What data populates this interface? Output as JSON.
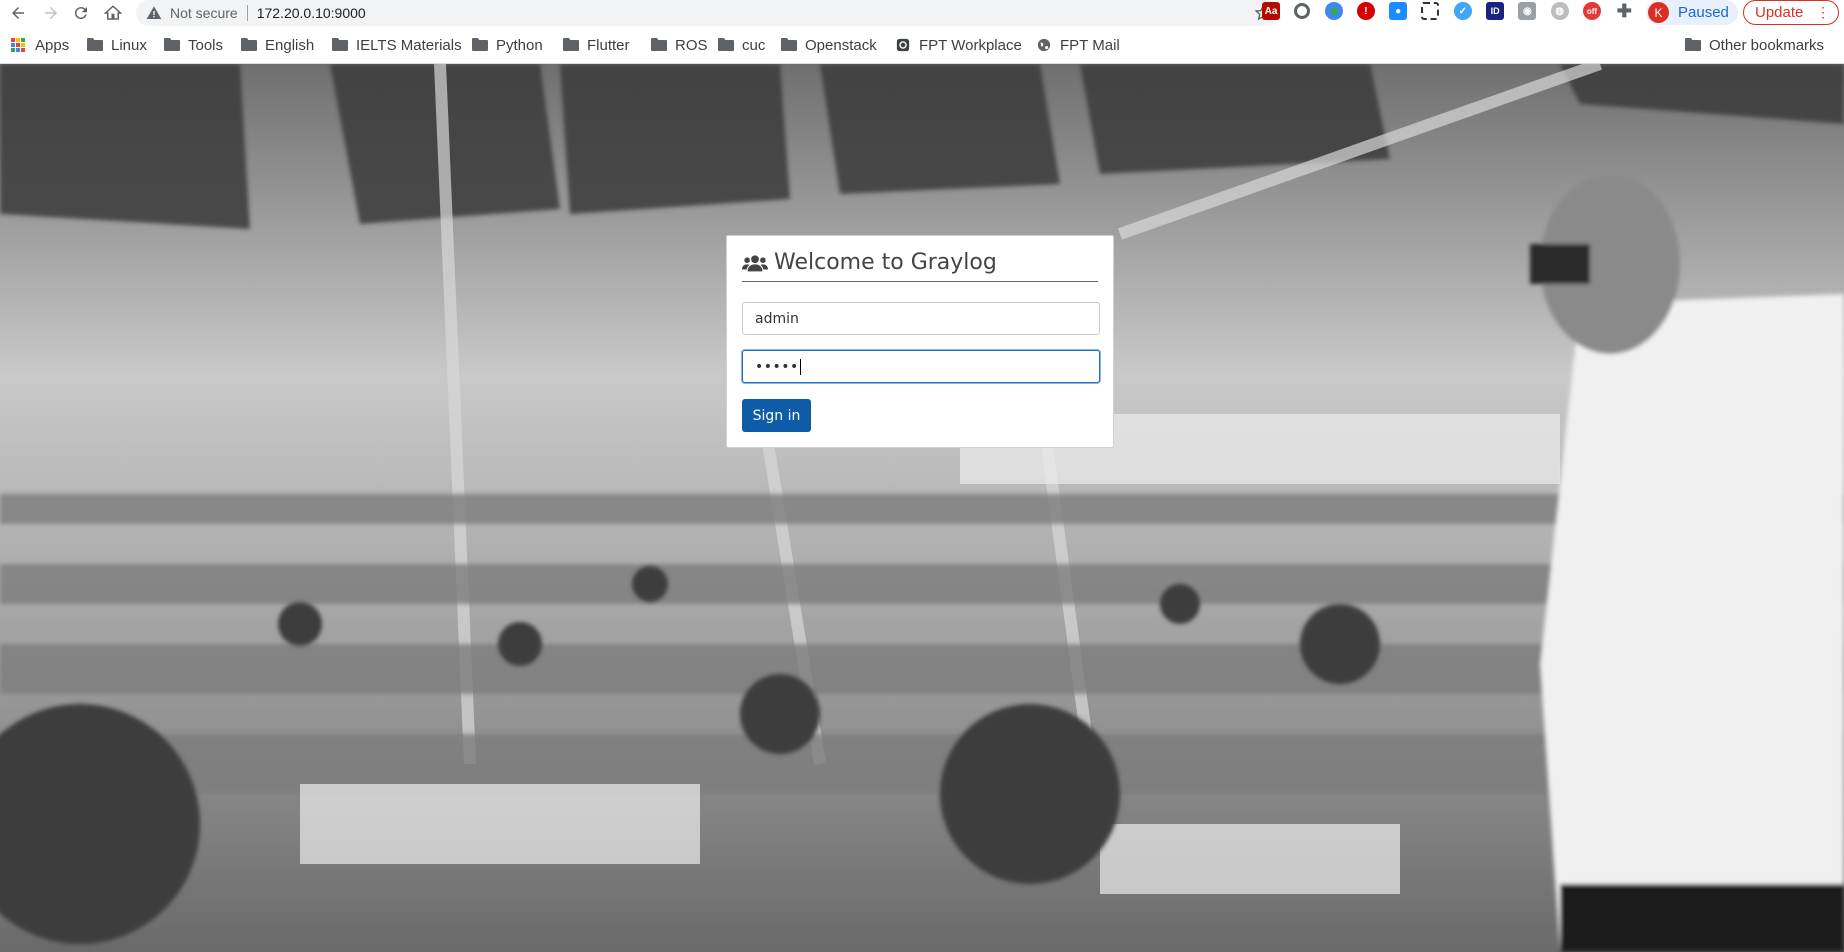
{
  "browser": {
    "security_label": "Not secure",
    "url": "172.20.0.10:9000",
    "profile_initial": "K",
    "profile_status": "Paused",
    "update_label": "Update",
    "extensions": [
      "acrobat-icon",
      "circle-icon",
      "earth-icon",
      "shield-icon",
      "drop-icon",
      "qr-icon",
      "bird-icon",
      "id-icon",
      "camera-icon",
      "globe-icon",
      "badge-icon",
      "puzzle-icon"
    ]
  },
  "bookmarks": {
    "apps_label": "Apps",
    "items": [
      "Linux",
      "Tools",
      "English",
      "IELTS Materials",
      "Python",
      "Flutter",
      "ROS",
      "cuc",
      "Openstack"
    ],
    "fpt_workplace": "FPT Workplace",
    "fpt_mail": "FPT Mail",
    "other": "Other bookmarks"
  },
  "login": {
    "title": "Welcome to Graylog",
    "username_value": "admin",
    "password_value": "•••••",
    "signin_label": "Sign in"
  }
}
